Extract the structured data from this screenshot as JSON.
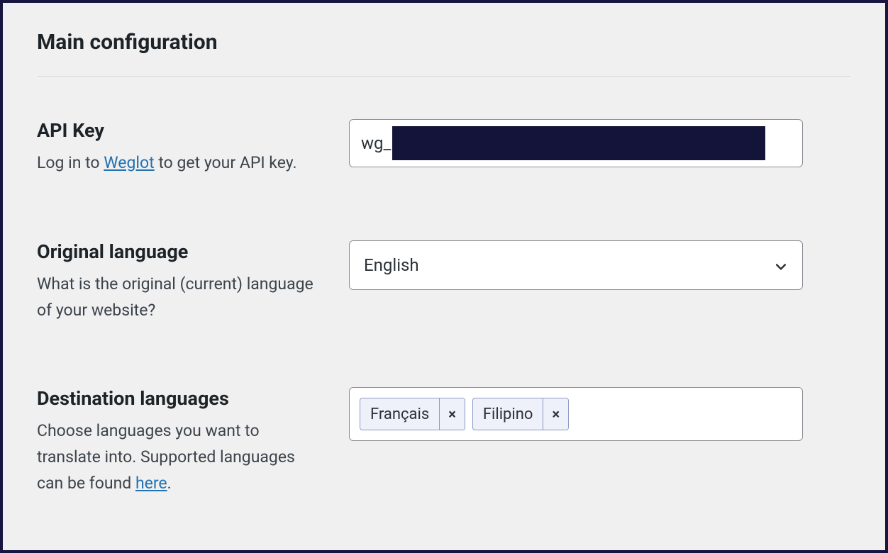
{
  "section": {
    "title": "Main configuration"
  },
  "fields": {
    "api_key": {
      "label": "API Key",
      "desc_prefix": "Log in to ",
      "desc_link": "Weglot",
      "desc_suffix": " to get your API key.",
      "value_visible": "wg_"
    },
    "original_language": {
      "label": "Original language",
      "desc": "What is the original (current) language of your website?",
      "selected": "English"
    },
    "destination_languages": {
      "label": "Destination languages",
      "desc_prefix": "Choose languages you want to translate into. Supported languages can be found ",
      "desc_link": "here",
      "desc_suffix": ".",
      "tags": [
        "Français",
        "Filipino"
      ],
      "remove_symbol": "×"
    }
  }
}
